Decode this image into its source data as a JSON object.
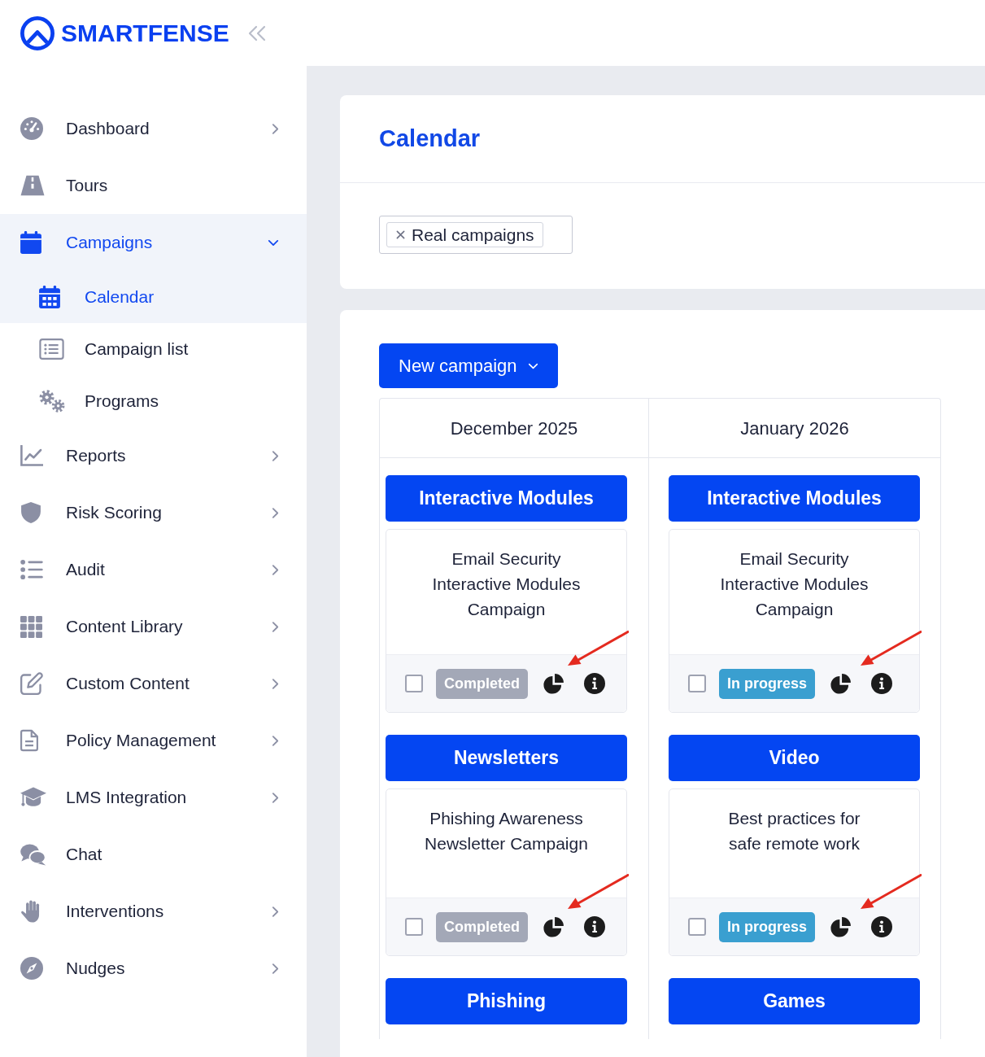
{
  "sidebar": {
    "logo": "SMARTFENSE",
    "items": [
      {
        "label": "Dashboard",
        "kind": "group",
        "expanded": false,
        "selected": false
      },
      {
        "label": "Tours",
        "kind": "link",
        "selected": false
      },
      {
        "label": "Campaigns",
        "kind": "group",
        "expanded": true,
        "selected": true,
        "children": [
          {
            "label": "Calendar",
            "selected": true
          },
          {
            "label": "Campaign list",
            "selected": false
          },
          {
            "label": "Programs",
            "selected": false
          }
        ]
      },
      {
        "label": "Reports",
        "kind": "group",
        "expanded": false,
        "selected": false
      },
      {
        "label": "Risk Scoring",
        "kind": "group",
        "expanded": false,
        "selected": false
      },
      {
        "label": "Audit",
        "kind": "group",
        "expanded": false,
        "selected": false
      },
      {
        "label": "Content Library",
        "kind": "group",
        "expanded": false,
        "selected": false
      },
      {
        "label": "Custom Content",
        "kind": "group",
        "expanded": false,
        "selected": false
      },
      {
        "label": "Policy Management",
        "kind": "group",
        "expanded": false,
        "selected": false
      },
      {
        "label": "LMS Integration",
        "kind": "group",
        "expanded": false,
        "selected": false
      },
      {
        "label": "Chat",
        "kind": "link",
        "selected": false
      },
      {
        "label": "Interventions",
        "kind": "group",
        "expanded": false,
        "selected": false
      },
      {
        "label": "Nudges",
        "kind": "group",
        "expanded": false,
        "selected": false
      }
    ]
  },
  "page": {
    "title": "Calendar"
  },
  "filter": {
    "tags": [
      {
        "label": "Real campaigns"
      }
    ]
  },
  "new_campaign_button": {
    "label": "New campaign"
  },
  "calendar": {
    "months": [
      {
        "label": "December 2025",
        "events": [
          {
            "category": "Interactive Modules",
            "title": "Email Security Interactive Modules Campaign",
            "checked": false,
            "status": {
              "label": "Completed",
              "kind": "completed"
            },
            "annotation_arrow": true
          },
          {
            "category": "Newsletters",
            "title": "Phishing Awareness Newsletter Campaign",
            "checked": false,
            "status": {
              "label": "Completed",
              "kind": "completed"
            },
            "annotation_arrow": true
          },
          {
            "category": "Phishing"
          }
        ]
      },
      {
        "label": "January 2026",
        "events": [
          {
            "category": "Interactive Modules",
            "title": "Email Security Interactive Modules Campaign",
            "checked": false,
            "status": {
              "label": "In progress",
              "kind": "in_progress"
            },
            "annotation_arrow": true
          },
          {
            "category": "Video",
            "title": "Best practices for safe remote work",
            "checked": false,
            "status": {
              "label": "In progress",
              "kind": "in_progress"
            },
            "annotation_arrow": true
          },
          {
            "category": "Games"
          }
        ]
      }
    ]
  }
}
